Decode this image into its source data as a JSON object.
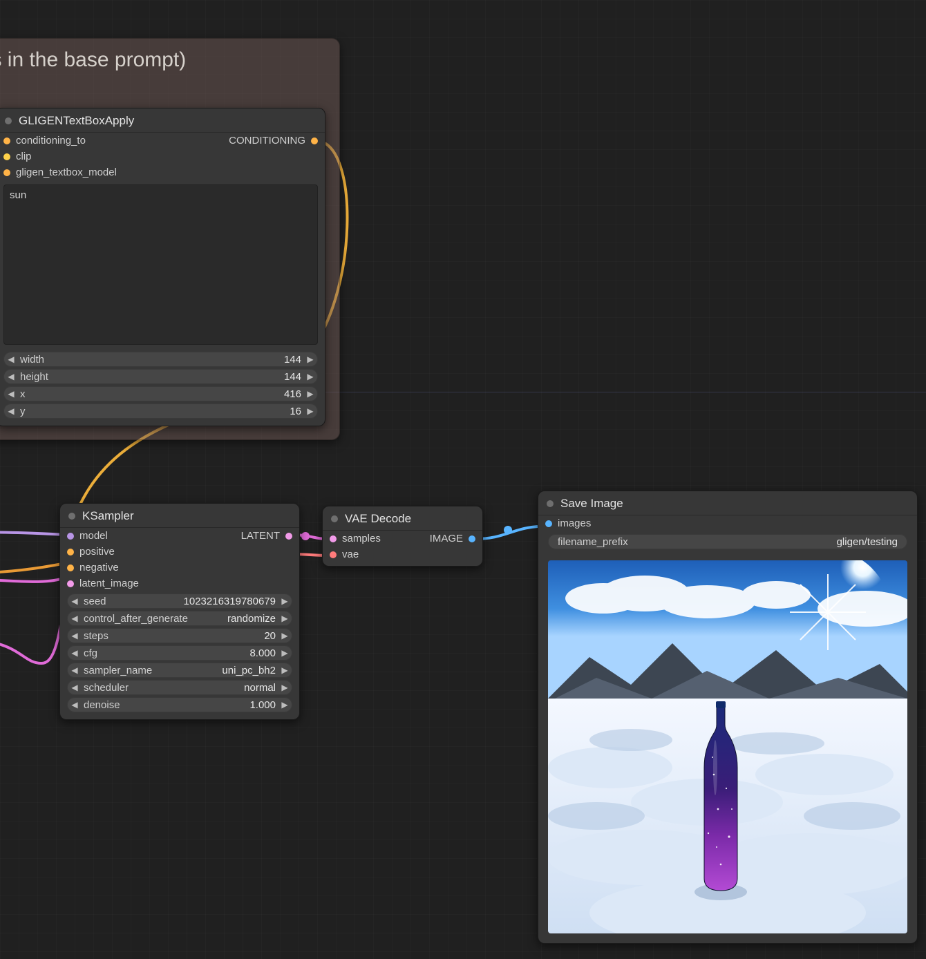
{
  "group": {
    "title": "ch some elements in the base prompt)"
  },
  "nodes": {
    "gligen": {
      "title": "GLIGENTextBoxApply",
      "inputs": [
        "conditioning_to",
        "clip",
        "gligen_textbox_model"
      ],
      "outputs": [
        "CONDITIONING"
      ],
      "text": "sun",
      "widgets": [
        {
          "label": "width",
          "value": "144"
        },
        {
          "label": "height",
          "value": "144"
        },
        {
          "label": "x",
          "value": "416"
        },
        {
          "label": "y",
          "value": "16"
        }
      ]
    },
    "ksampler": {
      "title": "KSampler",
      "inputs": [
        "model",
        "positive",
        "negative",
        "latent_image"
      ],
      "outputs": [
        "LATENT"
      ],
      "widgets": [
        {
          "label": "seed",
          "value": "1023216319780679"
        },
        {
          "label": "control_after_generate",
          "value": "randomize"
        },
        {
          "label": "steps",
          "value": "20"
        },
        {
          "label": "cfg",
          "value": "8.000"
        },
        {
          "label": "sampler_name",
          "value": "uni_pc_bh2"
        },
        {
          "label": "scheduler",
          "value": "normal"
        },
        {
          "label": "denoise",
          "value": "1.000"
        }
      ]
    },
    "vae": {
      "title": "VAE Decode",
      "inputs": [
        "samples",
        "vae"
      ],
      "outputs": [
        "IMAGE"
      ]
    },
    "save": {
      "title": "Save Image",
      "inputs": [
        "images"
      ],
      "widgets": [
        {
          "label": "filename_prefix",
          "value": "gligen/testing"
        }
      ]
    }
  },
  "port_colors": {
    "CONDITIONING": "#ffb347",
    "CLIP": "#ffd24a",
    "MODEL": "#b895e6",
    "LATENT": "#f29be9",
    "VAE": "#ff7b7b",
    "IMAGE": "#58b4ff"
  }
}
